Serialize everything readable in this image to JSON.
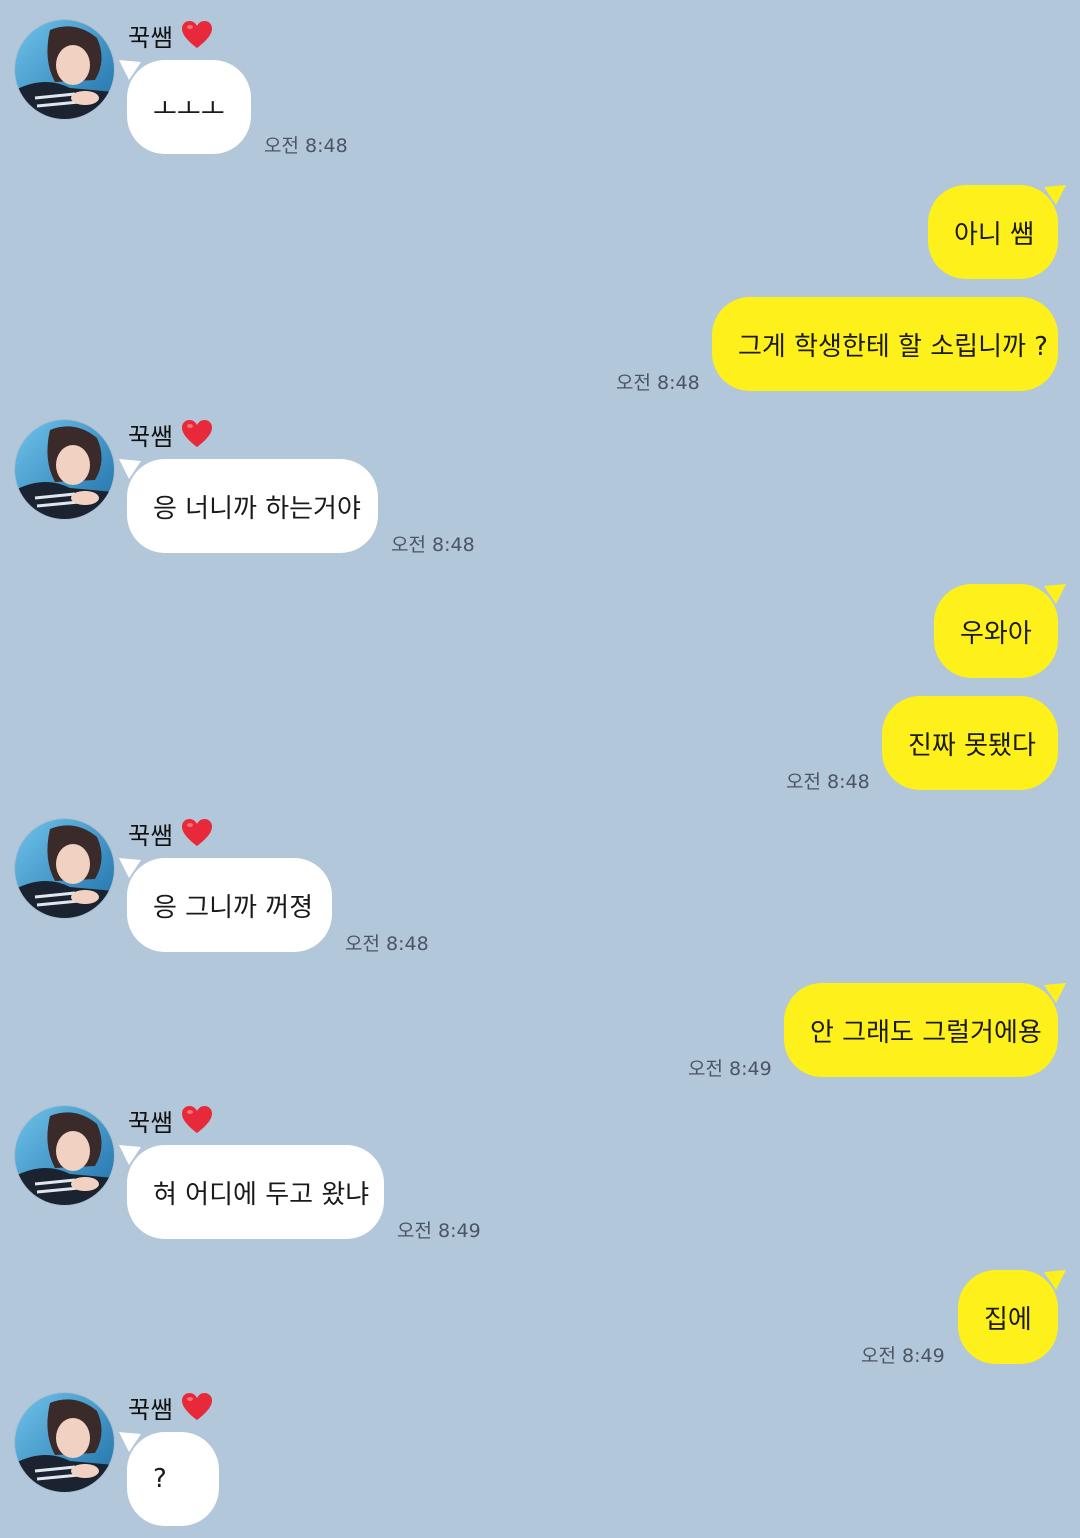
{
  "colors": {
    "background": "#b2c7da",
    "incoming_bubble": "#ffffff",
    "outgoing_bubble": "#fef01b",
    "heart": "#e8293a"
  },
  "contact": {
    "name": "꾹쌤",
    "badge_icon": "red-heart-icon",
    "avatar_icon": "profile-photo-avatar"
  },
  "messages": [
    {
      "side": "in",
      "text": "ㅗㅗㅗ",
      "time": "오전 8:48"
    },
    {
      "side": "out",
      "text": "아니 쌤",
      "time": ""
    },
    {
      "side": "out",
      "text": "그게 학생한테 할 소립니까 ?",
      "time": "오전 8:48"
    },
    {
      "side": "in",
      "text": "응 너니까 하는거야",
      "time": "오전 8:48"
    },
    {
      "side": "out",
      "text": "우와아",
      "time": ""
    },
    {
      "side": "out",
      "text": "진짜 못됐다",
      "time": "오전 8:48"
    },
    {
      "side": "in",
      "text": "응 그니까 꺼졍",
      "time": "오전 8:48"
    },
    {
      "side": "out",
      "text": "안 그래도 그럴거에용",
      "time": "오전 8:49"
    },
    {
      "side": "in",
      "text": "혀 어디에 두고 왔냐",
      "time": "오전 8:49"
    },
    {
      "side": "out",
      "text": "집에",
      "time": "오전 8:49"
    },
    {
      "side": "in",
      "text": "?",
      "time": ""
    }
  ]
}
